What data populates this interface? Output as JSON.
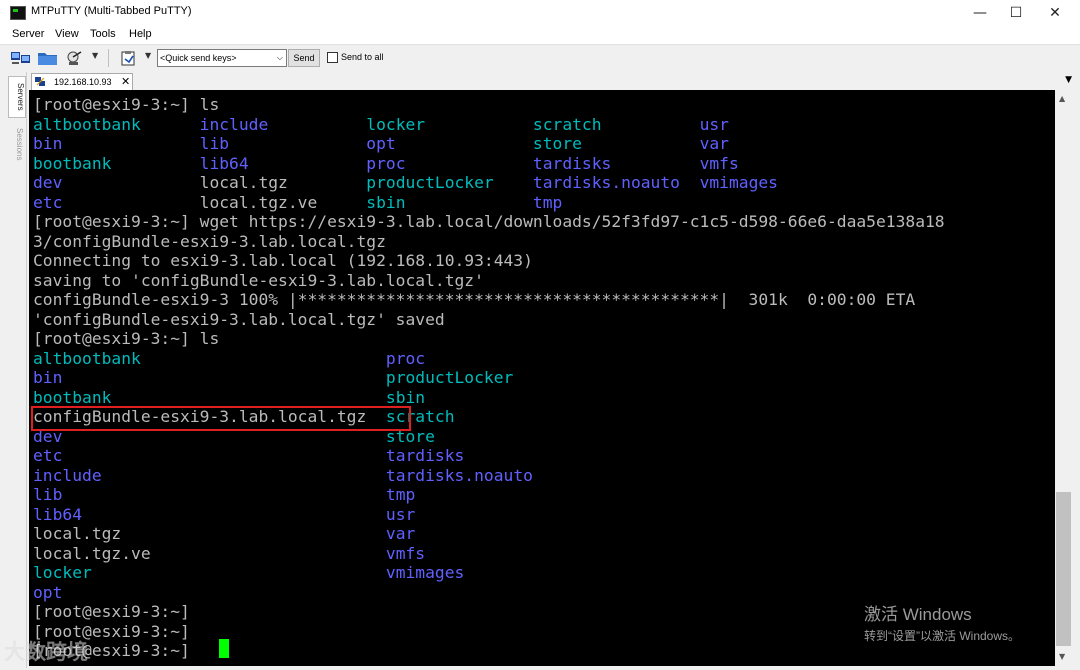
{
  "window": {
    "title": "MTPuTTY (Multi-Tabbed PuTTY)",
    "minimize": "—",
    "maximize": "☐",
    "close": "✕"
  },
  "menu": [
    "Server",
    "View",
    "Tools",
    "Help"
  ],
  "toolbar": {
    "quick_send_value": "<Quick send keys>",
    "send_label": "Send",
    "send_to_all_label": "Send to all",
    "send_to_all_checked": false,
    "icons": [
      "connect-icon",
      "folder-icon",
      "satellite-icon",
      "paste-icon"
    ]
  },
  "side_tabs": [
    "Servers",
    "Sessions"
  ],
  "tab": {
    "label": "192.168.10.93",
    "close": "✕",
    "icon": "putty-session-icon"
  },
  "terminal": {
    "colors": {
      "default": "#bbbbbb",
      "cyan": "#00bbbb",
      "blue": "#6060ff",
      "cursor": "#00ff00",
      "background": "#000000",
      "highlight": "#e02020"
    },
    "lines": [
      [
        {
          "t": "[root@esxi9-3:~] ls",
          "c": "def"
        }
      ],
      [
        {
          "t": "altbootbank      ",
          "c": "cyan"
        },
        {
          "t": "include          ",
          "c": "blue"
        },
        {
          "t": "locker           ",
          "c": "cyan"
        },
        {
          "t": "scratch          ",
          "c": "cyan"
        },
        {
          "t": "usr",
          "c": "blue"
        }
      ],
      [
        {
          "t": "bin              ",
          "c": "blue"
        },
        {
          "t": "lib              ",
          "c": "blue"
        },
        {
          "t": "opt              ",
          "c": "blue"
        },
        {
          "t": "store            ",
          "c": "cyan"
        },
        {
          "t": "var",
          "c": "blue"
        }
      ],
      [
        {
          "t": "bootbank         ",
          "c": "cyan"
        },
        {
          "t": "lib64            ",
          "c": "blue"
        },
        {
          "t": "proc             ",
          "c": "blue"
        },
        {
          "t": "tardisks         ",
          "c": "blue"
        },
        {
          "t": "vmfs",
          "c": "blue"
        }
      ],
      [
        {
          "t": "dev              ",
          "c": "blue"
        },
        {
          "t": "local.tgz        ",
          "c": "def"
        },
        {
          "t": "productLocker    ",
          "c": "cyan"
        },
        {
          "t": "tardisks.noauto  ",
          "c": "blue"
        },
        {
          "t": "vmimages",
          "c": "blue"
        }
      ],
      [
        {
          "t": "etc              ",
          "c": "blue"
        },
        {
          "t": "local.tgz.ve     ",
          "c": "def"
        },
        {
          "t": "sbin             ",
          "c": "cyan"
        },
        {
          "t": "tmp",
          "c": "blue"
        }
      ],
      [
        {
          "t": "[root@esxi9-3:~] wget https://esxi9-3.lab.local/downloads/52f3fd97-c1c5-d598-66e6-daa5e138a18",
          "c": "def"
        }
      ],
      [
        {
          "t": "3/configBundle-esxi9-3.lab.local.tgz",
          "c": "def"
        }
      ],
      [
        {
          "t": "Connecting to esxi9-3.lab.local (192.168.10.93:443)",
          "c": "def"
        }
      ],
      [
        {
          "t": "saving to 'configBundle-esxi9-3.lab.local.tgz'",
          "c": "def"
        }
      ],
      [
        {
          "t": "configBundle-esxi9-3 100% |*******************************************|  301k  0:00:00 ETA",
          "c": "def"
        }
      ],
      [
        {
          "t": "'configBundle-esxi9-3.lab.local.tgz' saved",
          "c": "def"
        }
      ],
      [
        {
          "t": "[root@esxi9-3:~] ls",
          "c": "def"
        }
      ],
      [
        {
          "t": "altbootbank                         ",
          "c": "cyan"
        },
        {
          "t": "proc",
          "c": "blue"
        }
      ],
      [
        {
          "t": "bin                                 ",
          "c": "blue"
        },
        {
          "t": "productLocker",
          "c": "cyan"
        }
      ],
      [
        {
          "t": "bootbank                            ",
          "c": "cyan"
        },
        {
          "t": "sbin",
          "c": "cyan"
        }
      ],
      [
        {
          "t": "configBundle-esxi9-3.lab.local.tgz  ",
          "c": "def"
        },
        {
          "t": "scratch",
          "c": "cyan"
        }
      ],
      [
        {
          "t": "dev                                 ",
          "c": "blue"
        },
        {
          "t": "store",
          "c": "cyan"
        }
      ],
      [
        {
          "t": "etc                                 ",
          "c": "blue"
        },
        {
          "t": "tardisks",
          "c": "blue"
        }
      ],
      [
        {
          "t": "include                             ",
          "c": "blue"
        },
        {
          "t": "tardisks.noauto",
          "c": "blue"
        }
      ],
      [
        {
          "t": "lib                                 ",
          "c": "blue"
        },
        {
          "t": "tmp",
          "c": "blue"
        }
      ],
      [
        {
          "t": "lib64                               ",
          "c": "blue"
        },
        {
          "t": "usr",
          "c": "blue"
        }
      ],
      [
        {
          "t": "local.tgz                           ",
          "c": "def"
        },
        {
          "t": "var",
          "c": "blue"
        }
      ],
      [
        {
          "t": "local.tgz.ve                        ",
          "c": "def"
        },
        {
          "t": "vmfs",
          "c": "blue"
        }
      ],
      [
        {
          "t": "locker                              ",
          "c": "cyan"
        },
        {
          "t": "vmimages",
          "c": "blue"
        }
      ],
      [
        {
          "t": "opt",
          "c": "blue"
        }
      ],
      [
        {
          "t": "[root@esxi9-3:~]",
          "c": "def"
        }
      ],
      [
        {
          "t": "[root@esxi9-3:~]",
          "c": "def"
        }
      ],
      [
        {
          "t": "[root@esxi9-3:~] ",
          "c": "def"
        }
      ]
    ]
  },
  "watermark": {
    "line1": "激活 Windows",
    "line2": "转到“设置”以激活 Windows。"
  },
  "brand_watermark": "大数跨境"
}
